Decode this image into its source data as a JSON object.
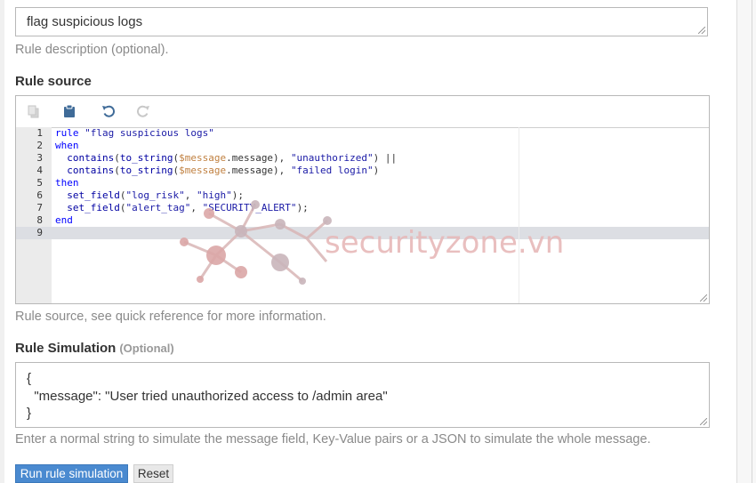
{
  "description": {
    "value": "flag suspicious logs",
    "help": "Rule description (optional)."
  },
  "rule_source": {
    "label": "Rule source",
    "help": "Rule source, see quick reference for more information.",
    "toolbar": [
      "copy-icon",
      "paste-icon",
      "undo-icon",
      "redo-icon"
    ],
    "line_numbers": [
      "1",
      "2",
      "3",
      "4",
      "5",
      "6",
      "7",
      "8",
      "9"
    ],
    "active_line": "9"
  },
  "simulation": {
    "label": "Rule Simulation",
    "optional": "(Optional)",
    "lines": [
      "{",
      "  \"message\": \"User tried unauthorized access to /admin area\"",
      "}"
    ],
    "help": "Enter a normal string to simulate the message field, Key-Value pairs or a JSON to simulate the whole message."
  },
  "buttons": {
    "run": "Run rule simulation",
    "reset": "Reset"
  },
  "watermark": "securityzone.vn",
  "colors": {
    "primary": "#4a8ad0",
    "keyword": "#0000ff",
    "string": "#1a1aa6",
    "variable": "#c08040",
    "watermark": "#e7b9b9"
  }
}
